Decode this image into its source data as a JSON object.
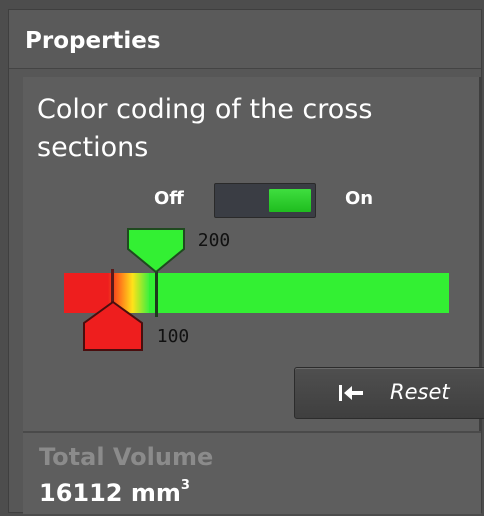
{
  "header": {
    "title": "Properties"
  },
  "section": {
    "title": "Color coding of the cross sections"
  },
  "toggle": {
    "off_label": "Off",
    "on_label": "On",
    "state": "on",
    "active_color": "#33cc33"
  },
  "slider": {
    "upper_marker": "200",
    "lower_marker": "100",
    "colors": {
      "low": "#ee1e1e",
      "mid": "#ffe21a",
      "high": "#33f033"
    }
  },
  "reset": {
    "label": "Reset",
    "icon": "skip-to-start-icon"
  },
  "volume": {
    "label": "Total Volume",
    "value": "16112 mm",
    "unit_exponent": "3"
  }
}
